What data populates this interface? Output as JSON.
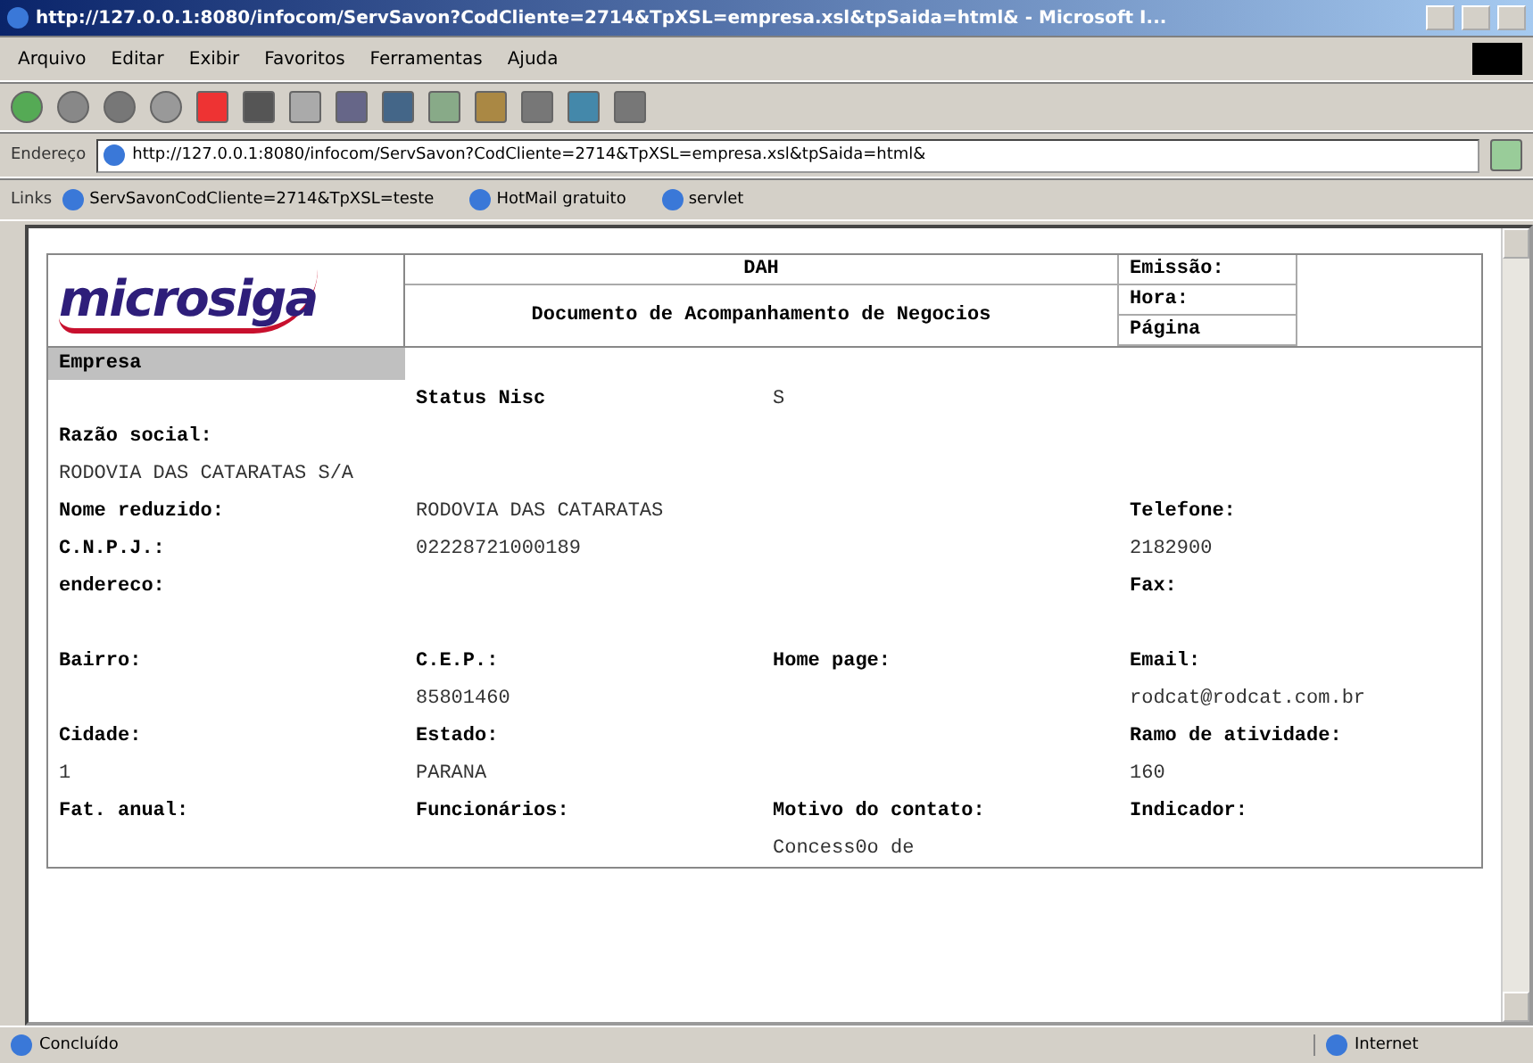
{
  "window": {
    "title": "http://127.0.0.1:8080/infocom/ServSavon?CodCliente=2714&TpXSL=empresa.xsl&tpSaida=html& - Microsoft I..."
  },
  "menu": [
    "Arquivo",
    "Editar",
    "Exibir",
    "Favoritos",
    "Ferramentas",
    "Ajuda"
  ],
  "address": {
    "label": "Endereço",
    "value": "http://127.0.0.1:8080/infocom/ServSavon?CodCliente=2714&TpXSL=empresa.xsl&tpSaida=html&"
  },
  "links": {
    "label": "Links",
    "items": [
      "ServSavonCodCliente=2714&TpXSL=teste",
      "HotMail gratuito",
      "servlet"
    ]
  },
  "document": {
    "logo": "microsiga",
    "title": "DAH",
    "subtitle": "Documento de Acompanhamento de Negocios",
    "meta": [
      "Emissão:",
      "Hora:",
      "Página"
    ],
    "section": "Empresa",
    "rows": [
      [
        null,
        {
          "kind": "label",
          "text": "Status Nisc"
        },
        {
          "kind": "value",
          "text": "S"
        },
        null
      ],
      [
        {
          "kind": "label",
          "text": "Razão social:"
        },
        null,
        null,
        null
      ],
      [
        {
          "kind": "value",
          "text": "RODOVIA DAS CATARATAS S/A"
        },
        null,
        null,
        null
      ],
      [
        {
          "kind": "label",
          "text": "Nome reduzido:"
        },
        {
          "kind": "value",
          "text": "RODOVIA DAS CATARATAS"
        },
        null,
        {
          "kind": "label",
          "text": "Telefone:"
        }
      ],
      [
        {
          "kind": "label",
          "text": "C.N.P.J.:"
        },
        {
          "kind": "value",
          "text": "02228721000189"
        },
        null,
        {
          "kind": "value",
          "text": "2182900"
        }
      ],
      [
        {
          "kind": "label",
          "text": "endereco:"
        },
        null,
        null,
        {
          "kind": "label",
          "text": "Fax:"
        }
      ],
      [
        null,
        null,
        null,
        null
      ],
      [
        {
          "kind": "label",
          "text": "Bairro:"
        },
        {
          "kind": "label",
          "text": "C.E.P.:"
        },
        {
          "kind": "label",
          "text": "Home page:"
        },
        {
          "kind": "label",
          "text": "Email:"
        }
      ],
      [
        null,
        {
          "kind": "value",
          "text": "85801460"
        },
        null,
        {
          "kind": "value",
          "text": "rodcat@rodcat.com.br"
        }
      ],
      [
        {
          "kind": "label",
          "text": "Cidade:"
        },
        {
          "kind": "label",
          "text": "Estado:"
        },
        null,
        {
          "kind": "label",
          "text": "Ramo de atividade:"
        }
      ],
      [
        {
          "kind": "value",
          "text": "1"
        },
        {
          "kind": "value",
          "text": "PARANA"
        },
        null,
        {
          "kind": "value",
          "text": "160"
        }
      ],
      [
        {
          "kind": "label",
          "text": "Fat. anual:"
        },
        {
          "kind": "label",
          "text": "Funcionários:"
        },
        {
          "kind": "label",
          "text": "Motivo do contato:"
        },
        {
          "kind": "label",
          "text": "Indicador:"
        }
      ],
      [
        null,
        null,
        {
          "kind": "value",
          "text": "Concess0o de"
        },
        null
      ]
    ]
  },
  "status_bar": {
    "text": "Concluído",
    "zone": "Internet"
  }
}
